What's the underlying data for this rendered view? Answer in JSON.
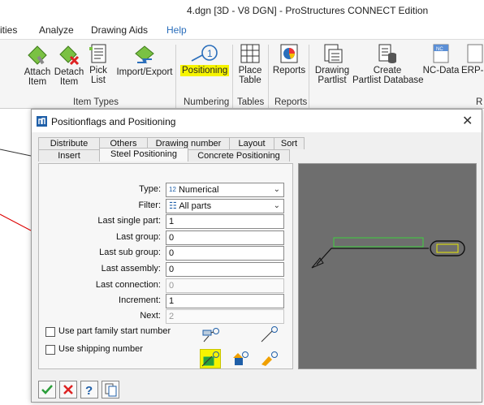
{
  "app": {
    "title": "4.dgn [3D - V8 DGN] - ProStructures CONNECT Edition"
  },
  "menu": [
    {
      "label": "ities"
    },
    {
      "label": "Analyze"
    },
    {
      "label": "Drawing Aids"
    },
    {
      "label": "Help"
    }
  ],
  "ribbon": {
    "buttons": [
      {
        "label": "Attach\nItem",
        "icon": "attach-item-icon"
      },
      {
        "label": "Detach\nItem",
        "icon": "detach-item-icon"
      },
      {
        "label": "Pick\nList",
        "icon": "pick-list-icon"
      },
      {
        "label": "Import/Export",
        "icon": "import-export-icon"
      },
      {
        "label": "Positioning",
        "icon": "positioning-icon"
      },
      {
        "label": "Place\nTable",
        "icon": "place-table-icon"
      },
      {
        "label": "Reports",
        "icon": "reports-icon"
      },
      {
        "label": "Drawing\nPartlist",
        "icon": "drawing-partlist-icon"
      },
      {
        "label": "Create\nPartlist Database",
        "icon": "create-partlist-database-icon"
      },
      {
        "label": "NC-Data",
        "icon": "nc-data-icon"
      },
      {
        "label": "ERP-I",
        "icon": "erp-icon"
      }
    ],
    "nc_icon_text": "NC",
    "groups": [
      "Item Types",
      "Numbering",
      "Tables",
      "Reports",
      "R"
    ],
    "highlight_color": "#f6f400"
  },
  "dialog": {
    "title": "Positionflags and Positioning",
    "close": "✕",
    "tabs_row1": [
      "Distribute",
      "Others",
      "Drawing number",
      "Layout",
      "Sort"
    ],
    "tabs_row2": [
      "Insert",
      "Steel Positioning",
      "Concrete Positioning"
    ],
    "selected_tab": "Steel Positioning",
    "fields": {
      "type_label": "Type:",
      "type_prefix": "12",
      "type_value": "Numerical",
      "filter_label": "Filter:",
      "filter_value": "All parts",
      "last_single_part_label": "Last single part:",
      "last_single_part_value": "1",
      "last_group_label": "Last group:",
      "last_group_value": "0",
      "last_sub_group_label": "Last sub group:",
      "last_sub_group_value": "0",
      "last_assembly_label": "Last assembly:",
      "last_assembly_value": "0",
      "last_connection_label": "Last connection:",
      "last_connection_value": "0",
      "increment_label": "Increment:",
      "increment_value": "1",
      "next_label": "Next:",
      "next_value": "2"
    },
    "checkboxes": [
      {
        "label": "Use part family start number",
        "checked": false
      },
      {
        "label": "Use shipping number",
        "checked": false
      }
    ],
    "footer_icons": [
      "ok-check-icon",
      "cancel-x-icon",
      "help-icon",
      "copy-icon"
    ]
  }
}
